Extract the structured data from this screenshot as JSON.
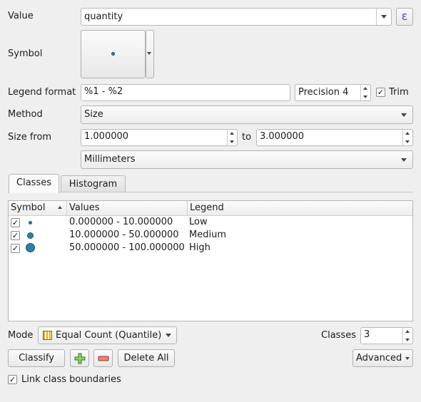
{
  "value": {
    "label": "Value",
    "field": "quantity",
    "expression_icon": "ε"
  },
  "symbol": {
    "label": "Symbol"
  },
  "legend_format": {
    "label": "Legend format",
    "value": "%1 - %2",
    "precision": "Precision 4",
    "trim_label": "Trim",
    "trim_checked": "✓"
  },
  "method": {
    "label": "Method",
    "value": "Size"
  },
  "size_from": {
    "label": "Size from",
    "from": "1.000000",
    "to_label": "to",
    "to": "3.000000",
    "unit": "Millimeters"
  },
  "tabs": [
    {
      "label": "Classes"
    },
    {
      "label": "Histogram"
    }
  ],
  "table": {
    "columns": [
      "Symbol",
      "Values",
      "Legend"
    ],
    "rows": [
      {
        "checked": "✓",
        "values": "0.000000 - 10.000000",
        "legend": "Low"
      },
      {
        "checked": "✓",
        "values": "10.000000 - 50.000000",
        "legend": "Medium"
      },
      {
        "checked": "✓",
        "values": "50.000000 - 100.000000",
        "legend": "High"
      }
    ]
  },
  "mode": {
    "label": "Mode",
    "value": "Equal Count (Quantile)"
  },
  "classes": {
    "label": "Classes",
    "value": "3"
  },
  "buttons": {
    "classify": "Classify",
    "delete_all": "Delete All",
    "advanced": "Advanced"
  },
  "link": {
    "label": "Link class boundaries",
    "checked": "✓"
  },
  "colors": {
    "symbol_fill": "#2e7fa5"
  }
}
